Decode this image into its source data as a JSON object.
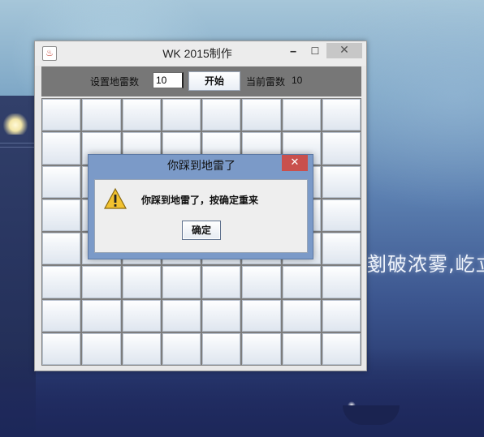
{
  "wallpaper": {
    "text": "剗破浓雾,屹立"
  },
  "window": {
    "title": "WK 2015制作",
    "controls": {
      "minimize": "‒",
      "maximize": "☐",
      "close": "✕"
    }
  },
  "toolbar": {
    "set_mines_label": "设置地雷数",
    "mines_input_value": "10",
    "start_label": "开始",
    "current_mines_label": "当前雷数",
    "current_mines_value": "10"
  },
  "board": {
    "rows": 8,
    "cols": 8
  },
  "dialog": {
    "title": "你踩到地雷了",
    "close": "✕",
    "message": "你踩到地雷了，按确定重来",
    "ok_label": "确定"
  },
  "colors": {
    "toolbar_bg": "#777777",
    "dialog_frame": "#7b9ac8",
    "dialog_close": "#c9504d",
    "warning": "#f2c230"
  },
  "icons": {
    "app": "java-cup-icon",
    "dialog": "warning-icon"
  }
}
